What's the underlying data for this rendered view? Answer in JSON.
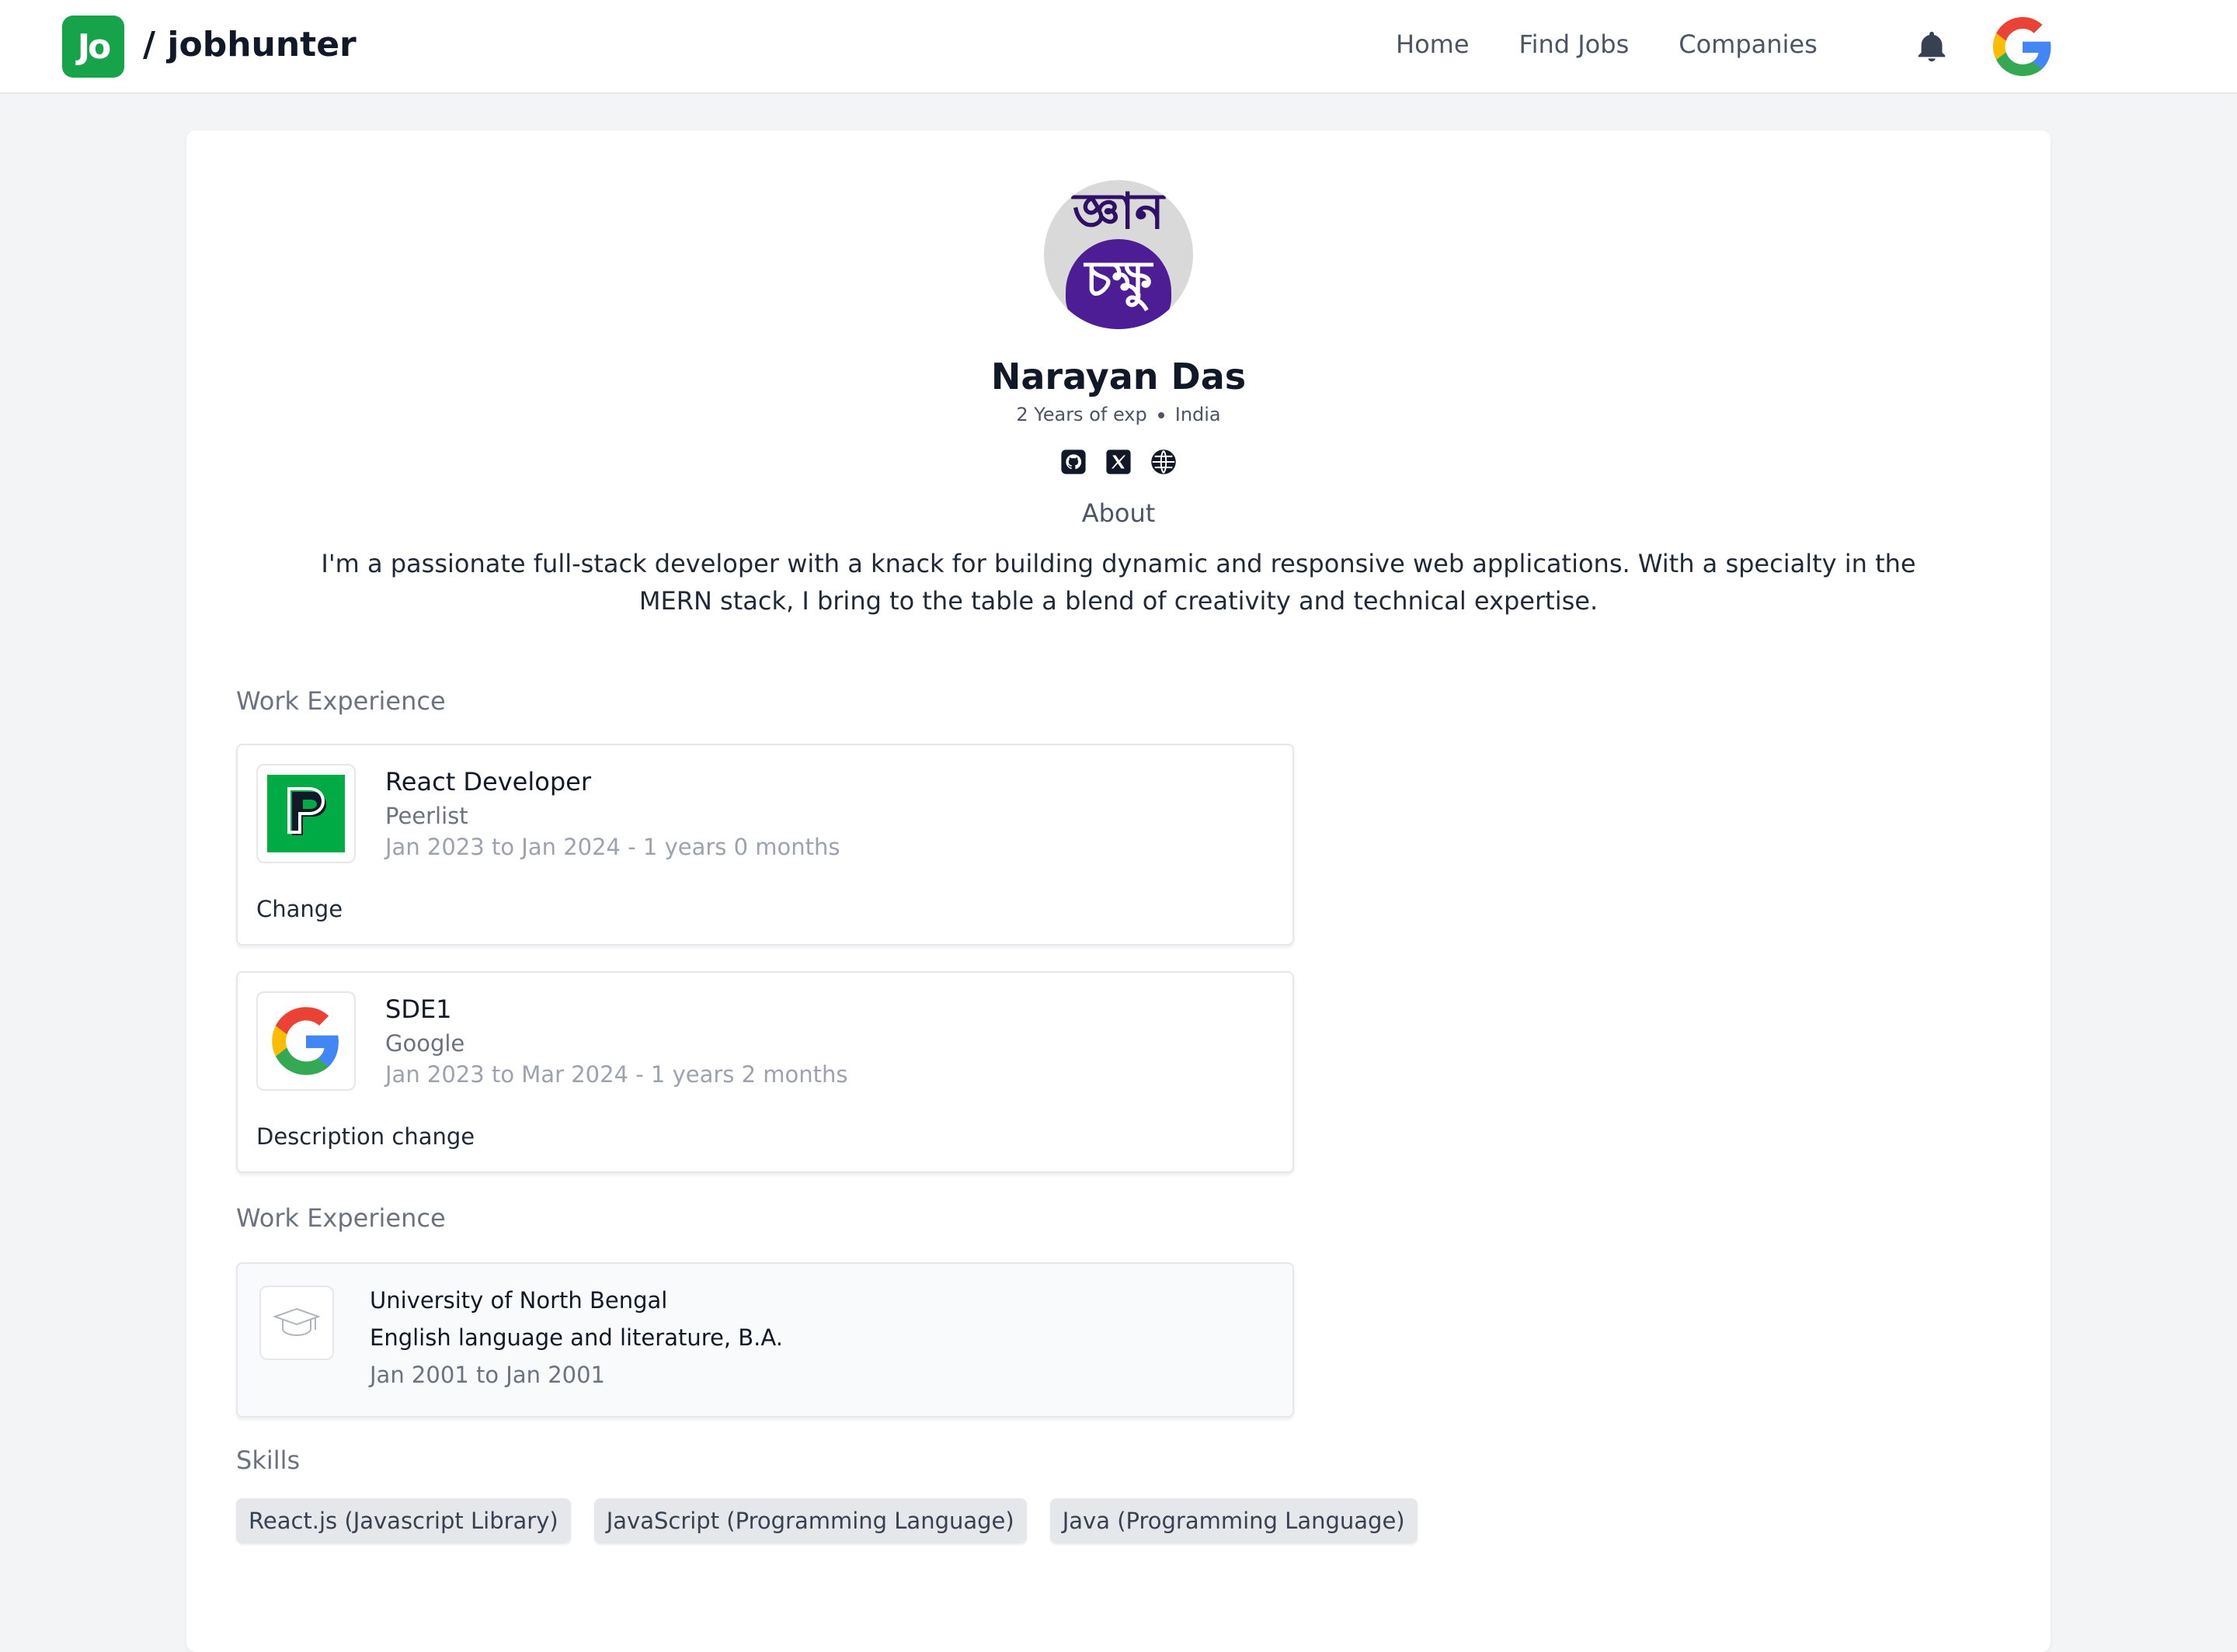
{
  "header": {
    "brand_logo_text": "Jo",
    "brand_name": "/ jobhunter",
    "nav": [
      "Home",
      "Find Jobs",
      "Companies"
    ],
    "icons": {
      "notifications": "bell-icon",
      "user_avatar": "google-g-logo"
    }
  },
  "profile": {
    "avatar_text_top": "জ্ঞান",
    "avatar_text_bottom": "চক্ষু",
    "name": "Narayan Das",
    "experience": "2 Years of exp",
    "location": "India",
    "social_icons": [
      "github-icon",
      "x-icon",
      "globe-icon"
    ],
    "about_title": "About",
    "about_text": "I'm a passionate full-stack developer with a knack for building dynamic and responsive web applications. With a specialty in the MERN stack, I bring to the table a blend of creativity and technical expertise."
  },
  "work": {
    "title": "Work Experience",
    "items": [
      {
        "role": "React Developer",
        "company": "Peerlist",
        "dates": "Jan 2023 to Jan 2024 - 1 years 0 months",
        "description": "Change",
        "logo": "peerlist-logo"
      },
      {
        "role": "SDE1",
        "company": "Google",
        "dates": "Jan 2023 to Mar 2024 - 1 years 2 months",
        "description": "Description change",
        "logo": "google-logo"
      }
    ]
  },
  "education": {
    "title": "Work Experience",
    "items": [
      {
        "school": "University of North Bengal",
        "degree": "English language and literature, B.A.",
        "dates": "Jan 2001 to Jan 2001",
        "icon": "graduation-cap-icon"
      }
    ]
  },
  "skills": {
    "title": "Skills",
    "items": [
      "React.js (Javascript Library)",
      "JavaScript (Programming Language)",
      "Java (Programming Language)"
    ]
  },
  "colors": {
    "brand_green": "#16a34a",
    "background": "#f3f4f6",
    "card": "#ffffff",
    "avatar_purple": "#4c1d95"
  }
}
